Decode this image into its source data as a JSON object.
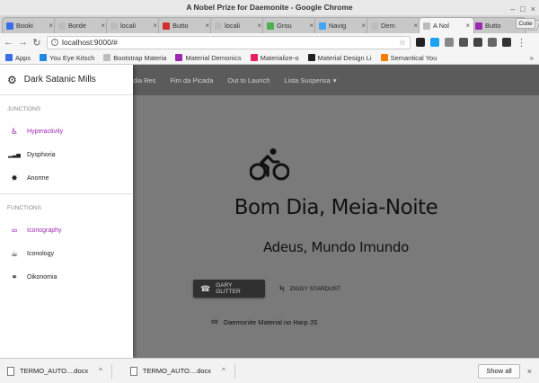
{
  "window": {
    "title": "A Nobel Prize for Daemonite - Google Chrome",
    "controls": [
      "–",
      "□",
      "×"
    ]
  },
  "tabs": [
    {
      "label": "Booki",
      "color": "#3a6ee8",
      "active": false
    },
    {
      "label": "Borde",
      "color": "#bdbdbd",
      "active": false
    },
    {
      "label": "locali",
      "color": "#bdbdbd",
      "active": false
    },
    {
      "label": "Butto",
      "color": "#d32f2f",
      "active": false
    },
    {
      "label": "locali",
      "color": "#bdbdbd",
      "active": false
    },
    {
      "label": "Grou",
      "color": "#4caf50",
      "active": false
    },
    {
      "label": "Navig",
      "color": "#42a5f5",
      "active": false
    },
    {
      "label": "Dem",
      "color": "#bdbdbd",
      "active": false
    },
    {
      "label": "A Nol",
      "color": "#bdbdbd",
      "active": true
    },
    {
      "label": "Butto",
      "color": "#9c27b0",
      "active": false
    }
  ],
  "profile_label": "Cutie",
  "omnibar": {
    "url": "localhost:9000/#",
    "back": "←",
    "forward": "→",
    "reload": "↻",
    "menu": "⋮"
  },
  "extensions": [
    "#222",
    "#1da1f2",
    "#888",
    "#555",
    "#444",
    "#666",
    "#333"
  ],
  "bookmarks": [
    {
      "label": "Apps",
      "color": "#3a6ee8"
    },
    {
      "label": "You Eye Kitsch",
      "color": "#1e88e5"
    },
    {
      "label": "Bootstrap Materia",
      "color": "#bdbdbd"
    },
    {
      "label": "Material Demonics",
      "color": "#9c27b0"
    },
    {
      "label": "Materialize-o",
      "color": "#e91e63"
    },
    {
      "label": "Material Design Li",
      "color": "#222"
    },
    {
      "label": "Semantical You",
      "color": "#f57c00"
    }
  ],
  "bookmarks_more": "»",
  "appbar": {
    "items": [
      "dia Res",
      "Fim da Picada",
      "Out to Launch",
      "Lista Suspensa"
    ],
    "dropdown_caret": "▾"
  },
  "sidebar": {
    "title": "Dark Satanic Mills",
    "sections": [
      {
        "heading": "Junctions",
        "items": [
          {
            "label": "Hyperactivity",
            "icon": "♿",
            "accent": true
          },
          {
            "label": "Dysphoria",
            "icon": "▂▃▅",
            "accent": false
          },
          {
            "label": "Anorme",
            "icon": "✸",
            "accent": false
          }
        ]
      },
      {
        "heading": "Functions",
        "items": [
          {
            "label": "Iconography",
            "icon": "∞",
            "accent": true
          },
          {
            "label": "Iconology",
            "icon": "☕",
            "accent": false
          },
          {
            "label": "Oikonomia",
            "icon": "⚭",
            "accent": false
          }
        ]
      }
    ]
  },
  "hero": {
    "title": "Bom Dia, Meia-Noite",
    "subtitle": "Adeus, Mundo Imundo",
    "buttons": [
      {
        "label": "Gary Glitter",
        "icon": "☎",
        "style": "dark"
      },
      {
        "label": "Ziggy Stardust",
        "icon": "ϟ",
        "style": "flat"
      }
    ],
    "footer_link": {
      "label": "Daemonite Material no Harp JS",
      "icon": "∞"
    }
  },
  "downloads": {
    "files": [
      "TERMO_AUTO....docx",
      "TERMO_AUTO....docx"
    ],
    "chevron": "^",
    "show_all": "Show all",
    "close": "×"
  },
  "colors": {
    "overlay": "#7a7a7a",
    "appbar": "#5b5b5b",
    "accent": "#9c27b0"
  }
}
